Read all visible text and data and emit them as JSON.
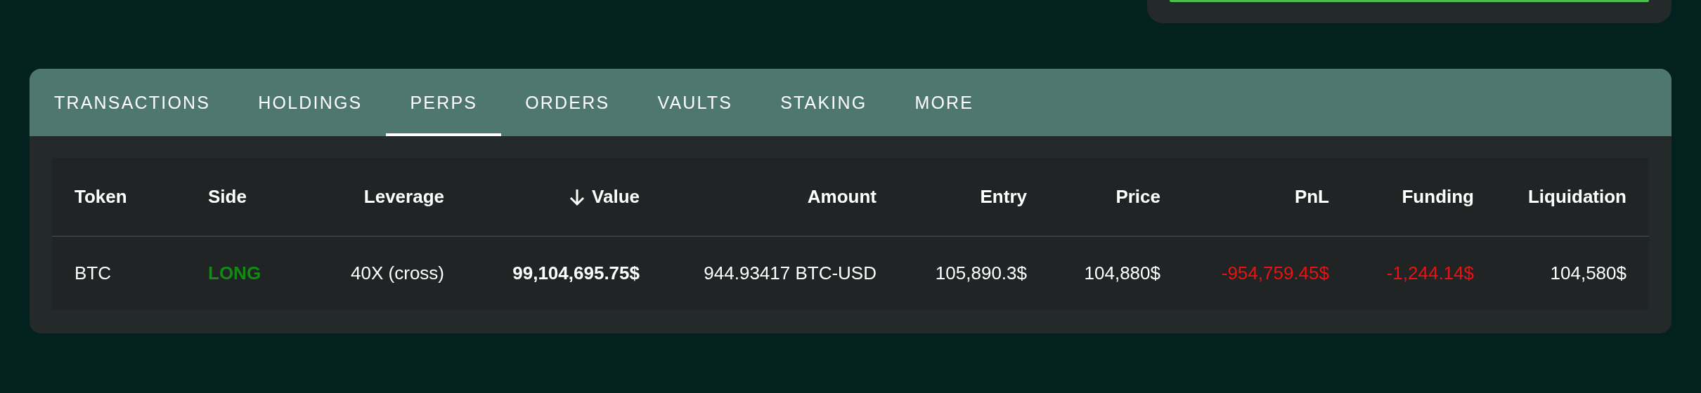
{
  "tabs": [
    {
      "label": "TRANSACTIONS",
      "selected": false
    },
    {
      "label": "HOLDINGS",
      "selected": false
    },
    {
      "label": "PERPS",
      "selected": true
    },
    {
      "label": "ORDERS",
      "selected": false
    },
    {
      "label": "VAULTS",
      "selected": false
    },
    {
      "label": "STAKING",
      "selected": false
    },
    {
      "label": "MORE",
      "selected": false
    }
  ],
  "table": {
    "columns": [
      {
        "label": "Token",
        "sorted": false
      },
      {
        "label": "Side",
        "sorted": false
      },
      {
        "label": "Leverage",
        "sorted": false
      },
      {
        "label": "Value",
        "sorted": true
      },
      {
        "label": "Amount",
        "sorted": false
      },
      {
        "label": "Entry",
        "sorted": false
      },
      {
        "label": "Price",
        "sorted": false
      },
      {
        "label": "PnL",
        "sorted": false
      },
      {
        "label": "Funding",
        "sorted": false
      },
      {
        "label": "Liquidation",
        "sorted": false
      }
    ],
    "rows": [
      {
        "cells": [
          {
            "text": "BTC",
            "kind": "plain"
          },
          {
            "text": "LONG",
            "kind": "long"
          },
          {
            "text": "40X (cross)",
            "kind": "plain"
          },
          {
            "text": "99,104,695.75$",
            "kind": "strong"
          },
          {
            "text": "944.93417 BTC-USD",
            "kind": "plain"
          },
          {
            "text": "105,890.3$",
            "kind": "plain"
          },
          {
            "text": "104,880$",
            "kind": "plain"
          },
          {
            "text": "-954,759.45$",
            "kind": "loss"
          },
          {
            "text": "-1,244.14$",
            "kind": "loss"
          },
          {
            "text": "104,580$",
            "kind": "plain"
          }
        ]
      }
    ]
  }
}
